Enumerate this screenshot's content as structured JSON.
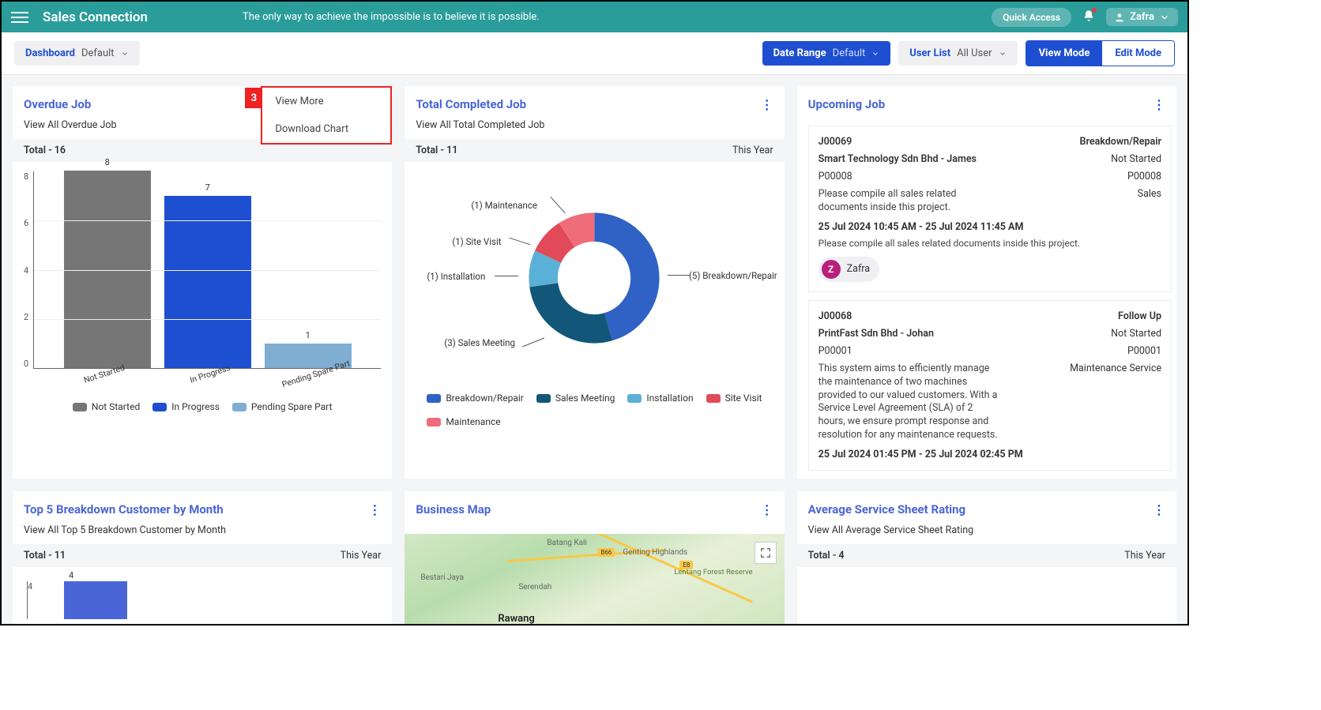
{
  "topbar": {
    "brand": "Sales Connection",
    "tagline": "The only way to achieve the impossible is to believe it is possible.",
    "quick": "Quick Access",
    "user": "Zafra"
  },
  "subbar": {
    "dashboard_lbl": "Dashboard",
    "dashboard_val": "Default",
    "date_lbl": "Date Range",
    "date_val": "Default",
    "user_lbl": "User List",
    "user_val": "All User",
    "view_mode": "View Mode",
    "edit_mode": "Edit Mode"
  },
  "overdue": {
    "title": "Overdue Job",
    "sub": "View All Overdue Job",
    "total": "Total - 16",
    "dropdown": {
      "badge": "3",
      "view_more": "View More",
      "download": "Download Chart"
    },
    "chart_data": {
      "type": "bar",
      "categories": [
        "Not Started",
        "In Progress",
        "Pending Spare Part"
      ],
      "values": [
        8,
        7,
        1
      ],
      "colors": [
        "#767676",
        "#1e4fd1",
        "#80aed3"
      ],
      "ylim": [
        0,
        8
      ],
      "yticks": [
        0,
        2,
        4,
        6,
        8
      ]
    },
    "legend": [
      {
        "label": "Not Started",
        "color": "#767676"
      },
      {
        "label": "In Progress",
        "color": "#1e4fd1"
      },
      {
        "label": "Pending Spare Part",
        "color": "#80aed3"
      }
    ]
  },
  "completed": {
    "title": "Total Completed Job",
    "sub": "View All Total Completed Job",
    "total": "Total - 11",
    "period": "This Year",
    "chart_data": {
      "type": "pie",
      "slices": [
        {
          "label": "Breakdown/Repair",
          "value": 5,
          "color": "#2f62c4",
          "callout": "(5) Breakdown/Repair"
        },
        {
          "label": "Sales Meeting",
          "value": 3,
          "color": "#12577a",
          "callout": "(3) Sales Meeting"
        },
        {
          "label": "Installation",
          "value": 1,
          "color": "#5bb0d7",
          "callout": "(1) Installation"
        },
        {
          "label": "Site Visit",
          "value": 1,
          "color": "#e24a5a",
          "callout": "(1) Site Visit"
        },
        {
          "label": "Maintenance",
          "value": 1,
          "color": "#ef6d7a",
          "callout": "(1) Maintenance"
        }
      ]
    },
    "legend": [
      {
        "label": "Breakdown/Repair",
        "color": "#2f62c4"
      },
      {
        "label": "Sales Meeting",
        "color": "#12577a"
      },
      {
        "label": "Installation",
        "color": "#5bb0d7"
      },
      {
        "label": "Site Visit",
        "color": "#e24a5a"
      },
      {
        "label": "Maintenance",
        "color": "#ef6d7a"
      }
    ]
  },
  "upcoming": {
    "title": "Upcoming Job",
    "jobs": [
      {
        "id": "J00069",
        "type": "Breakdown/Repair",
        "customer": "Smart Technology Sdn Bhd - James",
        "status": "Not Started",
        "code_l": "P00008",
        "code_r": "P00008",
        "desc": "Please compile all sales related documents inside this project.",
        "cat": "Sales",
        "datetime": "25 Jul 2024 10:45 AM - 25 Jul 2024 11:45 AM",
        "note": "Please compile all sales related documents inside this project.",
        "assignee": "Zafra",
        "avatar": "Z"
      },
      {
        "id": "J00068",
        "type": "Follow Up",
        "customer": "PrintFast Sdn Bhd - Johan",
        "status": "Not Started",
        "code_l": "P00001",
        "code_r": "P00001",
        "desc": "This system aims to efficiently manage the maintenance of two machines provided to our valued customers. With a Service Level Agreement (SLA) of 2 hours, we ensure prompt response and resolution for any maintenance requests.",
        "cat": "Maintenance Service",
        "datetime": "25 Jul 2024 01:45 PM - 25 Jul 2024 02:45 PM"
      }
    ]
  },
  "top5": {
    "title": "Top 5 Breakdown Customer by Month",
    "sub": "View All Top 5 Breakdown Customer by Month",
    "total": "Total - 11",
    "period": "This Year",
    "chart_data": {
      "type": "bar",
      "categories": [
        ""
      ],
      "values": [
        4
      ],
      "ylim": [
        0,
        4
      ]
    }
  },
  "map": {
    "title": "Business Map",
    "towns": [
      "Batang Kali",
      "Genting Highlands",
      "Bestari Jaya",
      "Serendah",
      "Rawang",
      "Lentang Forest Reserve"
    ],
    "badges": [
      "B66",
      "E8"
    ]
  },
  "rating": {
    "title": "Average Service Sheet Rating",
    "sub": "View All Average Service Sheet Rating",
    "total": "Total - 4",
    "period": "This Year"
  }
}
